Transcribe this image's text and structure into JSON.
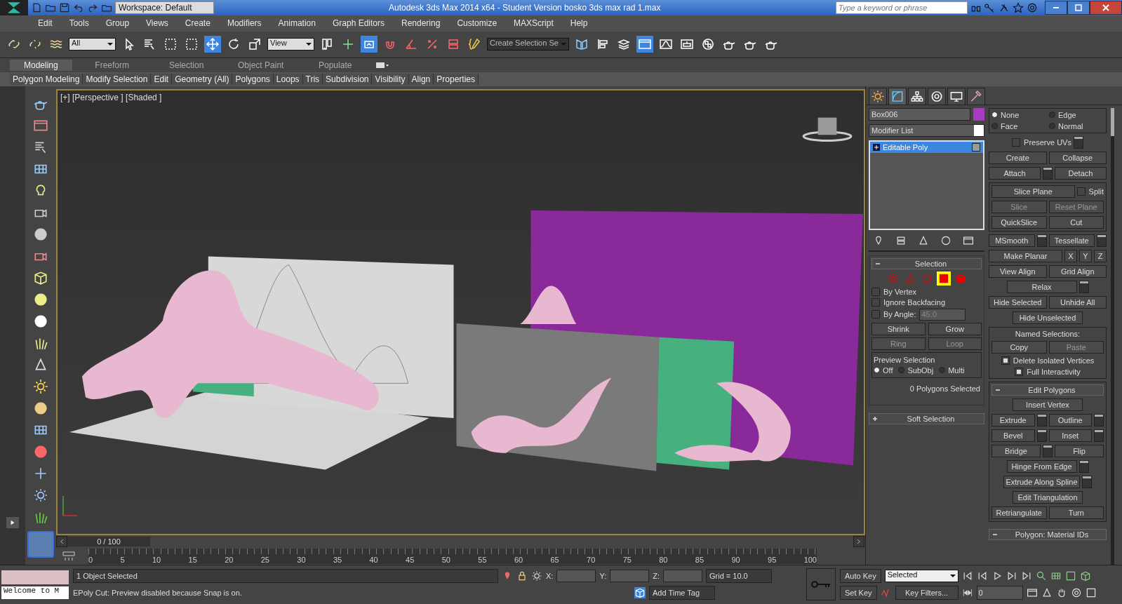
{
  "window": {
    "title": "Autodesk 3ds Max  2014 x64  - Student Version    bosko 3ds max rad 1.max",
    "workspace": "Workspace: Default",
    "search": {
      "placeholder": "Type a keyword or phrase"
    }
  },
  "menu": [
    "Edit",
    "Tools",
    "Group",
    "Views",
    "Create",
    "Modifiers",
    "Animation",
    "Graph Editors",
    "Rendering",
    "Customize",
    "MAXScript",
    "Help"
  ],
  "toolbar": {
    "selection_filter": "All",
    "reference_coordinate": "View",
    "named_selection": "Create Selection Se",
    "tools": [
      {
        "selected": false
      },
      {
        "selected": false
      },
      {
        "selected": false
      },
      {
        "selected": false
      },
      {
        "selected": false
      },
      {
        "selected": false
      },
      {
        "selected": false
      },
      {
        "selected": true
      },
      {
        "selected": false
      },
      {
        "selected": false
      },
      {
        "selected": false
      },
      {
        "selected": false
      },
      {
        "selected": true
      },
      {
        "selected": false
      },
      {
        "selected": false
      },
      {
        "selected": false
      },
      {
        "selected": false
      },
      {
        "selected": false
      },
      {
        "selected": false
      },
      {
        "selected": false
      },
      {
        "selected": false
      },
      {
        "selected": true
      },
      {
        "selected": false
      },
      {
        "selected": false
      },
      {
        "selected": false
      },
      {
        "selected": false
      },
      {
        "selected": false
      },
      {
        "selected": false
      }
    ]
  },
  "ribbon": {
    "tabs": [
      {
        "label": "Modeling",
        "selected": true
      },
      {
        "label": "Freeform",
        "selected": false
      },
      {
        "label": "Selection",
        "selected": false
      },
      {
        "label": "Object Paint",
        "selected": false
      },
      {
        "label": "Populate",
        "selected": false
      }
    ],
    "panels": [
      "Polygon Modeling",
      "Modify Selection",
      "Edit",
      "Geometry (All)",
      "Polygons",
      "Loops",
      "Tris",
      "Subdivision",
      "Visibility",
      "Align",
      "Properties"
    ]
  },
  "viewport": {
    "label": "[+] [Perspective ] [Shaded ]"
  },
  "command_panel": {
    "tabs": [
      {
        "selected": false
      },
      {
        "selected": true
      },
      {
        "selected": false
      },
      {
        "selected": false
      },
      {
        "selected": false
      },
      {
        "selected": false
      }
    ],
    "object_name": "Box006",
    "modifier_list": "Modifier List",
    "stack": [
      {
        "label": "Editable Poly",
        "selected": true
      }
    ],
    "selection": {
      "title": "Selection",
      "expanded": true,
      "levels": [
        {
          "selected": false
        },
        {
          "selected": false
        },
        {
          "selected": false
        },
        {
          "selected": true
        },
        {
          "selected": false
        }
      ],
      "options": [
        {
          "label": "By Vertex",
          "checked": false
        },
        {
          "label": "Ignore Backfacing",
          "checked": false
        },
        {
          "label": "By Angle:",
          "checked": false
        }
      ],
      "angle": "45.0",
      "buttons": [
        "Shrink",
        "Grow"
      ],
      "spinner_buttons": [
        "Ring",
        "Loop"
      ],
      "preview": {
        "title": "Preview Selection",
        "options": [
          {
            "label": "Off",
            "selected": true
          },
          {
            "label": "SubObj",
            "selected": false
          },
          {
            "label": "Multi",
            "selected": false
          }
        ]
      },
      "status": "0 Polygons Selected"
    },
    "soft_selection": {
      "title": "Soft Selection",
      "expanded": false
    },
    "constraints": [
      {
        "label": "None",
        "selected": true
      },
      {
        "label": "Edge",
        "selected": false
      },
      {
        "label": "Face",
        "selected": false
      },
      {
        "label": "Normal",
        "selected": false
      }
    ],
    "sections": [
      {
        "boxed": false,
        "rows": [
          [
            {
              "kind": "checkbox_settings",
              "label": "Preserve UVs",
              "checked": false
            }
          ],
          [
            {
              "kind": "button",
              "label": "Create",
              "disabled": false
            },
            {
              "kind": "button",
              "label": "Collapse",
              "disabled": false
            }
          ],
          [
            {
              "kind": "settings_button",
              "label": "Attach",
              "disabled": false
            },
            {
              "kind": "button",
              "label": "Detach",
              "disabled": false
            }
          ]
        ]
      },
      {
        "boxed": true,
        "rows": [
          [
            {
              "kind": "button",
              "label": "Slice Plane",
              "disabled": false
            },
            {
              "kind": "checkbox",
              "label": "Split",
              "checked": false
            }
          ],
          [
            {
              "kind": "button",
              "label": "Slice",
              "disabled": true
            },
            {
              "kind": "button",
              "label": "Reset Plane",
              "disabled": true
            }
          ],
          [
            {
              "kind": "button",
              "label": "QuickSlice",
              "disabled": false
            },
            {
              "kind": "button",
              "label": "Cut",
              "disabled": false
            }
          ]
        ]
      },
      {
        "boxed": false,
        "rows": [
          [
            {
              "kind": "settings_button",
              "label": "MSmooth",
              "disabled": false
            },
            {
              "kind": "settings_button",
              "label": "Tessellate",
              "disabled": false
            }
          ],
          [
            {
              "kind": "button",
              "label": "Make Planar",
              "disabled": false
            },
            {
              "kind": "small",
              "label": "X",
              "disabled": false
            },
            {
              "kind": "small",
              "label": "Y",
              "disabled": false
            },
            {
              "kind": "small",
              "label": "Z",
              "disabled": false
            }
          ],
          [
            {
              "kind": "button",
              "label": "View Align",
              "disabled": false
            },
            {
              "kind": "button",
              "label": "Grid Align",
              "disabled": false
            }
          ],
          [
            {
              "kind": "settings_button",
              "label": "Relax",
              "disabled": false
            }
          ],
          [
            {
              "kind": "button",
              "label": "Hide Selected",
              "disabled": false
            },
            {
              "kind": "button",
              "label": "Unhide All",
              "disabled": false
            }
          ],
          [
            {
              "kind": "button",
              "label": "Hide Unselected",
              "disabled": false
            }
          ]
        ]
      },
      {
        "boxed": true,
        "rows": [
          [
            {
              "kind": "label",
              "label": "Named Selections:"
            }
          ],
          [
            {
              "kind": "button",
              "label": "Copy",
              "disabled": false
            },
            {
              "kind": "button",
              "label": "Paste",
              "disabled": true
            }
          ],
          [
            {
              "kind": "checkbox",
              "label": "Delete Isolated Vertices",
              "checked": true
            }
          ],
          [
            {
              "kind": "checkbox",
              "label": "Full Interactivity",
              "checked": true
            }
          ]
        ]
      }
    ],
    "edit_polygons": {
      "title": "Edit Polygons",
      "expanded": true,
      "rows": [
        [
          {
            "kind": "button",
            "label": "Insert Vertex",
            "disabled": false
          }
        ],
        [
          {
            "kind": "settings_button",
            "label": "Extrude",
            "disabled": false
          },
          {
            "kind": "settings_button",
            "label": "Outline",
            "disabled": false
          }
        ],
        [
          {
            "kind": "settings_button",
            "label": "Bevel",
            "disabled": false
          },
          {
            "kind": "settings_button",
            "label": "Inset",
            "disabled": false
          }
        ],
        [
          {
            "kind": "settings_button",
            "label": "Bridge",
            "disabled": false
          },
          {
            "kind": "button",
            "label": "Flip",
            "disabled": false
          }
        ],
        [
          {
            "kind": "settings_button",
            "label": "Hinge From Edge",
            "disabled": false
          }
        ],
        [
          {
            "kind": "settings_button",
            "label": "Extrude Along Spline",
            "disabled": false
          }
        ],
        [
          {
            "kind": "button",
            "label": "Edit Triangulation",
            "disabled": false
          }
        ],
        [
          {
            "kind": "button",
            "label": "Retriangulate",
            "disabled": false
          },
          {
            "kind": "button",
            "label": "Turn",
            "disabled": false
          }
        ]
      ]
    },
    "material_ids": {
      "title": "Polygon: Material IDs",
      "expanded": true
    }
  },
  "timeline": {
    "frame": "0 / 100",
    "ticks": [
      "0",
      "5",
      "10",
      "15",
      "20",
      "25",
      "30",
      "35",
      "40",
      "45",
      "50",
      "55",
      "60",
      "65",
      "70",
      "75",
      "80",
      "85",
      "90",
      "95",
      "100"
    ]
  },
  "status_bar": {
    "maxscript": "Welcome to M",
    "selection": "1 Object Selected",
    "prompt": "EPoly Cut: Preview disabled because Snap is on.",
    "x_label": "X:",
    "y_label": "Y:",
    "z_label": "Z:",
    "grid": "Grid = 10.0",
    "time_tag": "Add Time Tag",
    "auto_key": "Auto Key",
    "set_key": "Set Key",
    "key_mode": "Selected",
    "key_filters": "Key Filters...",
    "current_frame": "0"
  }
}
